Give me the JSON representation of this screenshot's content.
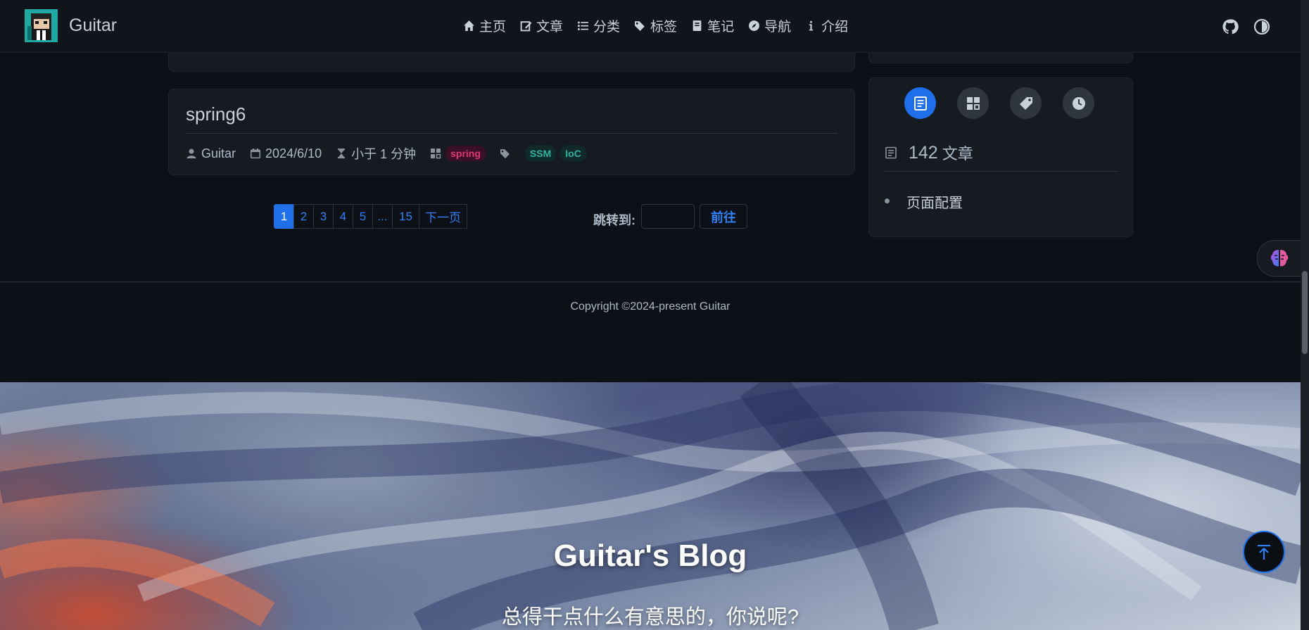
{
  "navbar": {
    "site_title": "Guitar",
    "items": [
      {
        "label": "主页",
        "icon": "home-icon"
      },
      {
        "label": "文章",
        "icon": "edit-icon"
      },
      {
        "label": "分类",
        "icon": "list-icon"
      },
      {
        "label": "标签",
        "icon": "tags-icon"
      },
      {
        "label": "笔记",
        "icon": "book-icon"
      },
      {
        "label": "导航",
        "icon": "compass-icon"
      },
      {
        "label": "介绍",
        "icon": "info-icon"
      }
    ]
  },
  "post": {
    "title": "spring6",
    "author": "Guitar",
    "date": "2024/6/10",
    "reading_time": "小于 1 分钟",
    "category": "spring",
    "tags": [
      "SSM",
      "IoC"
    ]
  },
  "pagination": {
    "pages": [
      "1",
      "2",
      "3",
      "4",
      "5",
      "...",
      "15"
    ],
    "current": "1",
    "next_label": "下一页",
    "jump_label": "跳转到:",
    "go_label": "前往"
  },
  "sidebar": {
    "article_count": "142",
    "article_label": "文章",
    "link": "页面配置"
  },
  "footer": {
    "copyright": "Copyright ©2024-present Guitar"
  },
  "hero": {
    "title": "Guitar's Blog",
    "subtitle": "总得干点什么有意思的，你说呢?"
  },
  "colors": {
    "accent": "#1f6feb",
    "background": "#0d1117",
    "card": "#161b22"
  }
}
